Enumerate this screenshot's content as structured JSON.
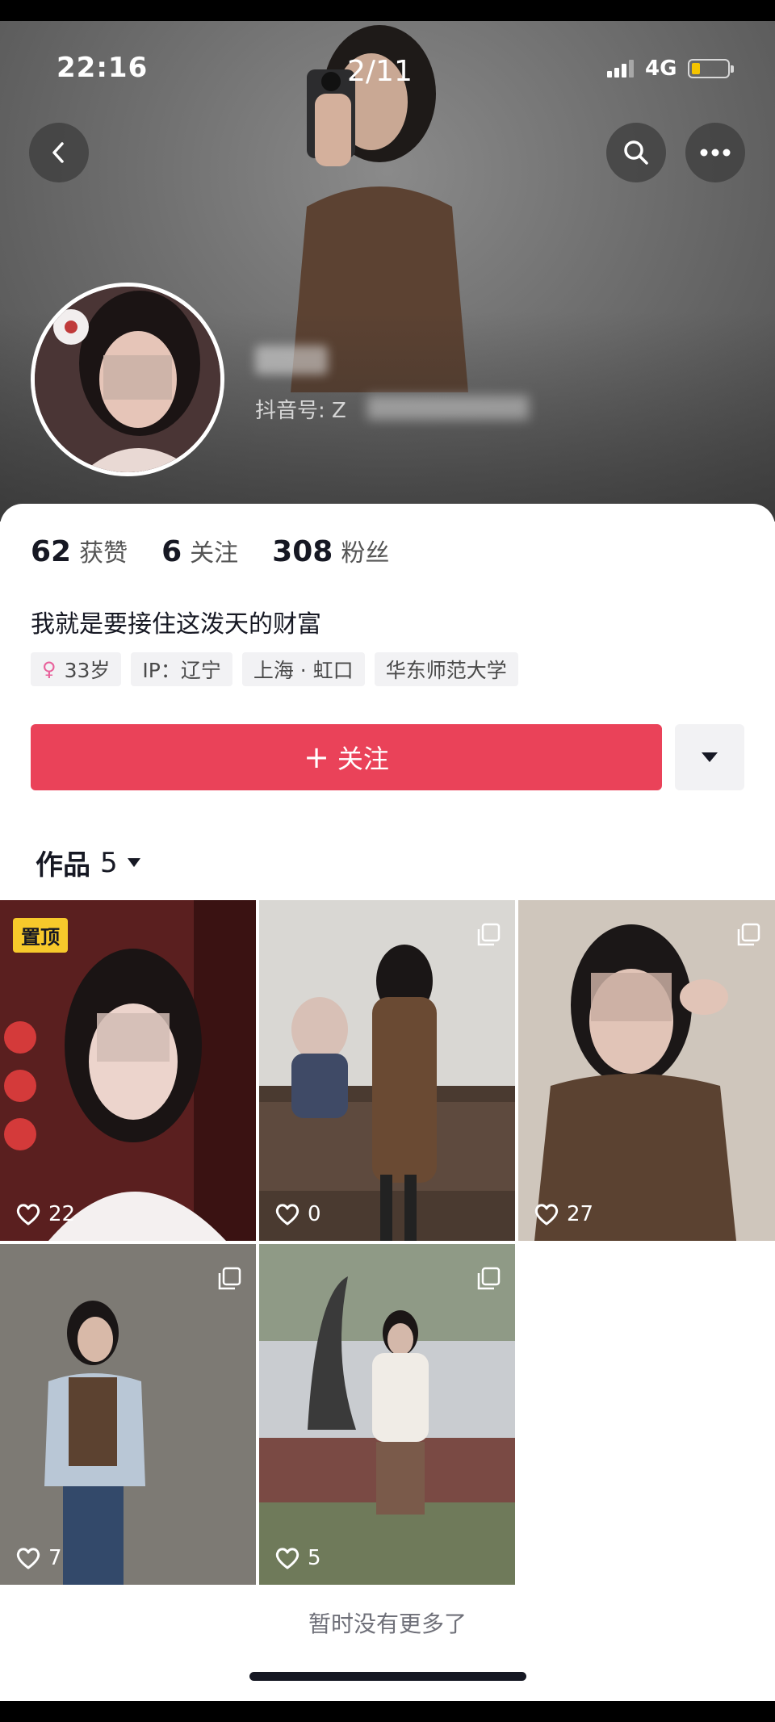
{
  "status_bar": {
    "time": "22:16",
    "network": "4G"
  },
  "viewer": {
    "page_counter": "2/11"
  },
  "header": {
    "back_icon": "chevron-left-icon",
    "search_icon": "search-icon",
    "more_icon": "more-horizontal-icon",
    "douyin_id_label": "抖音号: Z"
  },
  "stats": [
    {
      "value": "62",
      "label": "获赞"
    },
    {
      "value": "6",
      "label": "关注"
    },
    {
      "value": "308",
      "label": "粉丝"
    }
  ],
  "bio": "我就是要接住这泼天的财富",
  "tags": {
    "age": "33岁",
    "ip": "IP：辽宁",
    "location": "上海 · 虹口",
    "school": "华东师范大学"
  },
  "actions": {
    "follow_label": "关注",
    "follow_icon": "plus-icon",
    "dropdown_icon": "caret-down-icon"
  },
  "works": {
    "label": "作品",
    "count": "5"
  },
  "videos": [
    {
      "likes": "22",
      "pinned_label": "置顶"
    },
    {
      "likes": "0"
    },
    {
      "likes": "27"
    },
    {
      "likes": "7"
    },
    {
      "likes": "5"
    }
  ],
  "footer": {
    "end_text": "暂时没有更多了"
  },
  "colors": {
    "accent": "#ea4259",
    "pin": "#f7c92b",
    "female": "#e8619b"
  }
}
